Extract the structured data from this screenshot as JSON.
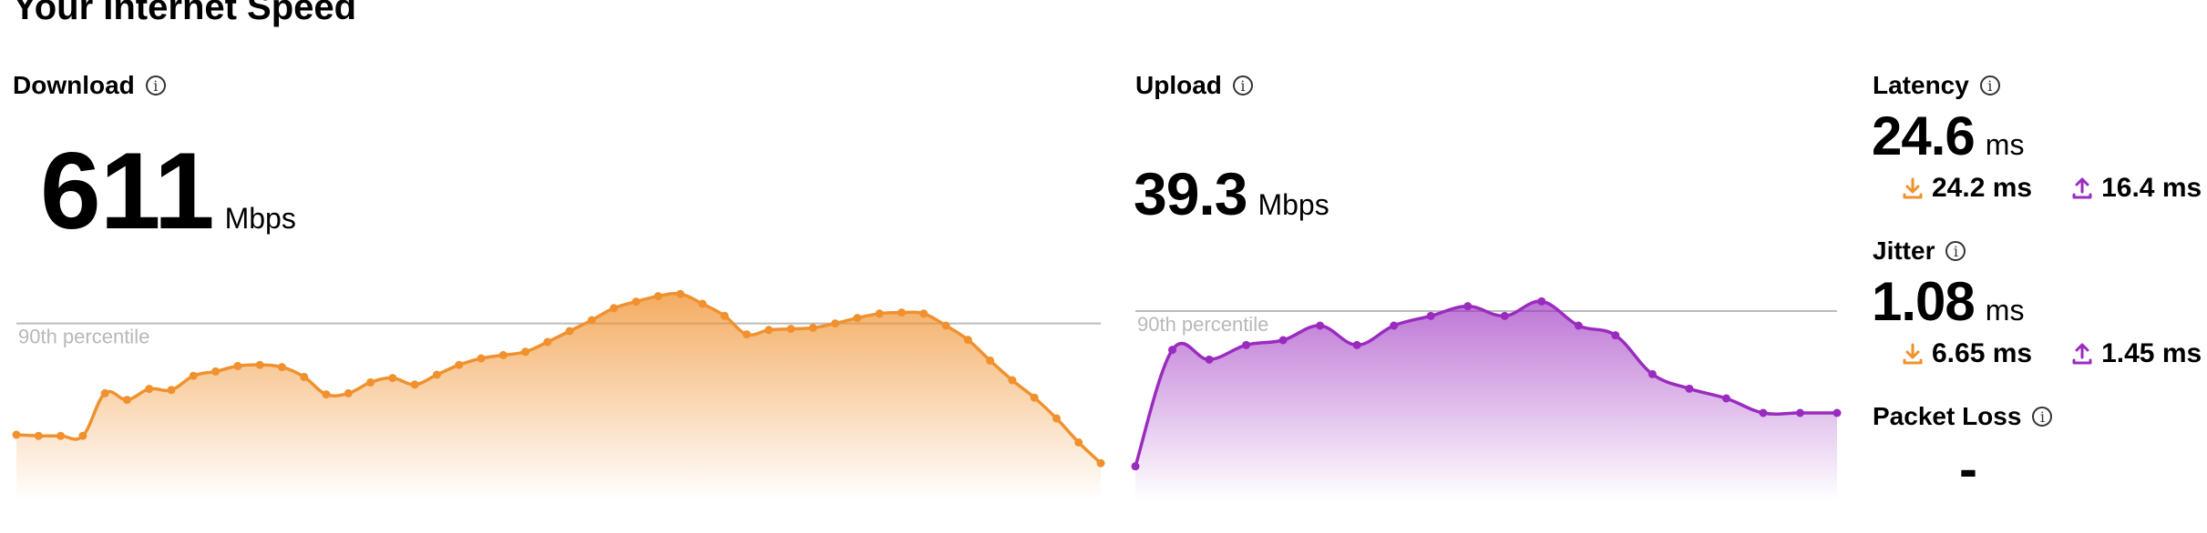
{
  "page_title": "Your Internet Speed",
  "colors": {
    "download": "#f0912e",
    "upload": "#9a2bbf",
    "gridline": "#bbbbbb",
    "percentile_text": "#b8b8b8"
  },
  "download": {
    "label": "Download",
    "value": "611",
    "unit": "Mbps",
    "percentile_label": "90th percentile"
  },
  "upload": {
    "label": "Upload",
    "value": "39.3",
    "unit": "Mbps",
    "percentile_label": "90th percentile"
  },
  "latency": {
    "label": "Latency",
    "value": "24.6",
    "unit": "ms",
    "down_value": "24.2 ms",
    "up_value": "16.4 ms"
  },
  "jitter": {
    "label": "Jitter",
    "value": "1.08",
    "unit": "ms",
    "down_value": "6.65 ms",
    "up_value": "1.45 ms"
  },
  "packet_loss": {
    "label": "Packet Loss",
    "value": "-"
  },
  "icons": [
    "info-icon",
    "download-arrow-icon",
    "upload-arrow-icon"
  ],
  "chart_data": [
    {
      "type": "area",
      "series": [
        {
          "values": [
            60,
            59,
            59,
            59,
            98,
            92,
            102,
            101,
            114,
            118,
            123,
            124,
            122,
            113,
            97,
            98,
            108,
            112,
            106,
            115,
            124,
            130,
            133,
            136,
            145,
            155,
            165,
            176,
            182,
            187,
            189,
            180,
            169,
            152,
            156,
            157,
            158,
            162,
            167,
            171,
            172,
            171,
            160,
            147,
            128,
            110,
            94,
            75,
            53,
            34
          ]
        }
      ],
      "reference_line": {
        "label": "90th percentile",
        "value": 162
      }
    },
    {
      "type": "area",
      "series": [
        {
          "values": [
            7,
            31,
            29,
            32,
            33,
            36,
            32,
            36,
            38,
            40,
            38,
            41,
            36,
            34,
            26,
            23,
            21,
            18,
            18,
            18
          ]
        }
      ],
      "reference_line": {
        "label": "90th percentile",
        "value": 39
      }
    }
  ]
}
